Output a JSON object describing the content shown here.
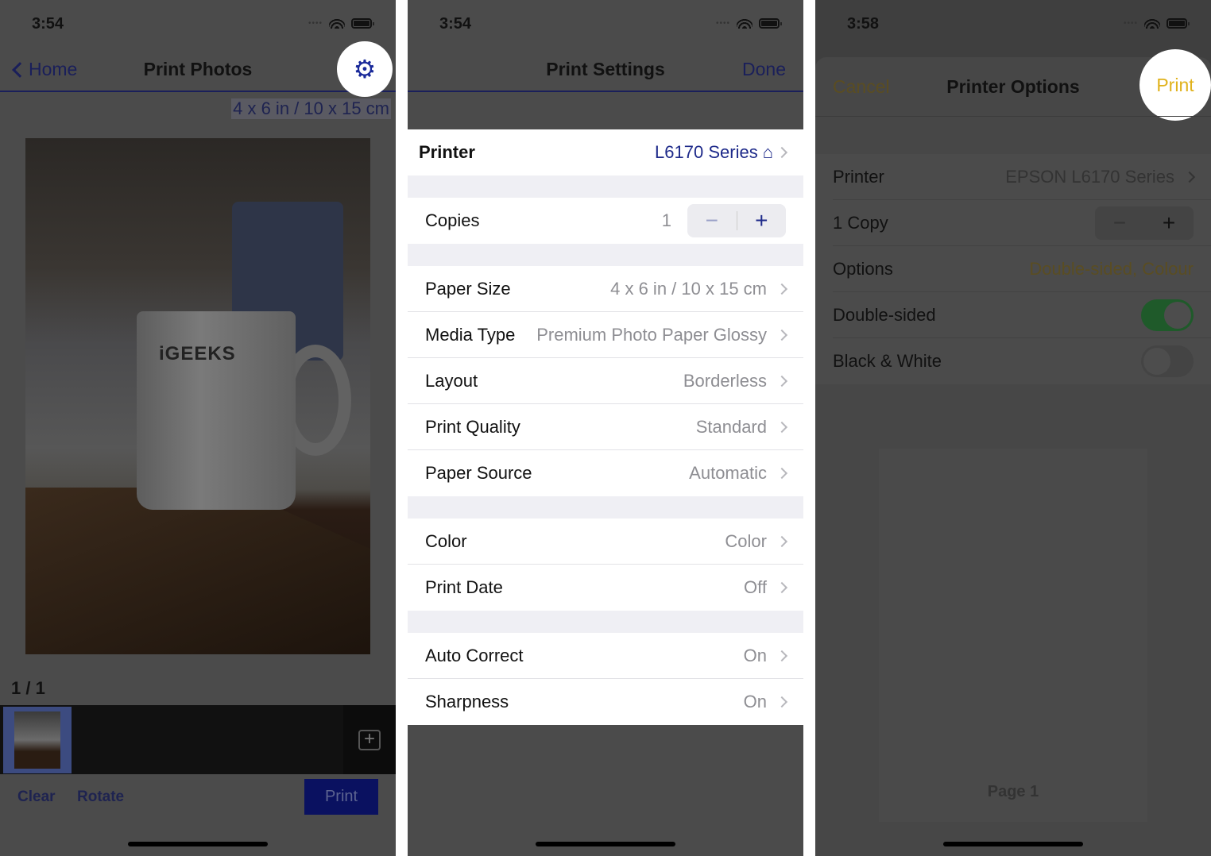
{
  "screens": {
    "print_photos": {
      "time": "3:54",
      "back_label": "Home",
      "title": "Print Photos",
      "settings_icon": "gear-icon",
      "paper_size": "4 x 6 in / 10 x 15 cm",
      "photo_brand": "iGEEKS",
      "page_counter": "1 / 1",
      "clear_label": "Clear",
      "rotate_label": "Rotate",
      "print_label": "Print",
      "accent": "#1a2a9a"
    },
    "print_settings": {
      "time": "3:54",
      "title": "Print Settings",
      "done_label": "Done",
      "printer": {
        "label": "Printer",
        "value": "L6170 Series"
      },
      "copies": {
        "label": "Copies",
        "value": "1",
        "minus": "−",
        "plus": "+"
      },
      "paper_group": [
        {
          "label": "Paper Size",
          "value": "4 x 6 in / 10 x 15 cm"
        },
        {
          "label": "Media Type",
          "value": "Premium Photo Paper Glossy"
        },
        {
          "label": "Layout",
          "value": "Borderless"
        },
        {
          "label": "Print Quality",
          "value": "Standard"
        },
        {
          "label": "Paper Source",
          "value": "Automatic"
        }
      ],
      "color_group": [
        {
          "label": "Color",
          "value": "Color"
        },
        {
          "label": "Print Date",
          "value": "Off"
        }
      ],
      "correct_group": [
        {
          "label": "Auto Correct",
          "value": "On"
        },
        {
          "label": "Sharpness",
          "value": "On"
        }
      ]
    },
    "printer_options": {
      "time": "3:58",
      "cancel_label": "Cancel",
      "title": "Printer Options",
      "print_label": "Print",
      "printer": {
        "label": "Printer",
        "value": "EPSON L6170 Series"
      },
      "copies": {
        "label": "1 Copy",
        "minus": "−",
        "plus": "+"
      },
      "options": {
        "label": "Options",
        "value": "Double-sided, Colour"
      },
      "double_sided": {
        "label": "Double-sided",
        "on": true
      },
      "black_white": {
        "label": "Black & White",
        "on": false
      },
      "page_label": "Page 1",
      "accent": "#e0b21c"
    }
  }
}
